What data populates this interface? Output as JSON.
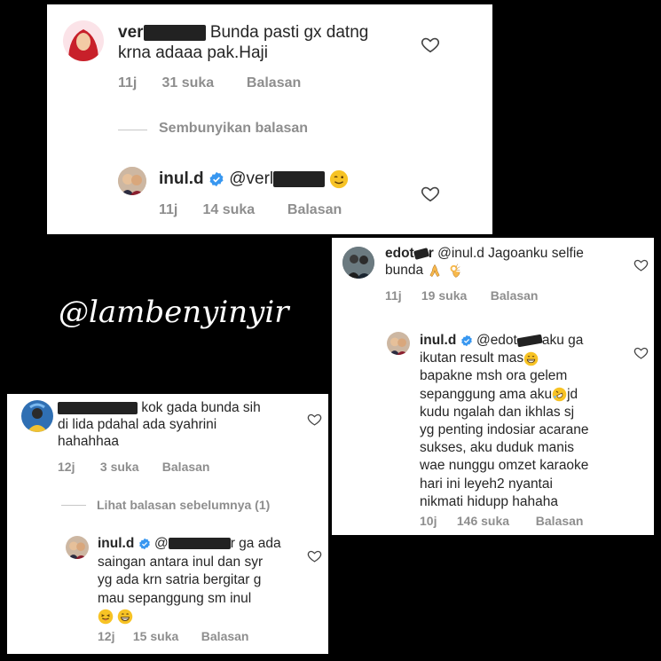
{
  "watermark": "@lambenyinyir",
  "card1": {
    "comment": {
      "username": "ver",
      "text_line1": "Bunda pasti gx datng",
      "text_line2": "krna adaaa pak.Haji",
      "time": "11j",
      "likes": "31 suka",
      "reply_label": "Balasan"
    },
    "hide_replies": "Sembunyikan balasan",
    "reply": {
      "username": "inul.d",
      "mention": "@verl",
      "time": "11j",
      "likes": "14 suka",
      "reply_label": "Balasan"
    }
  },
  "card2": {
    "comment": {
      "username": "edot",
      "username_tail": "r",
      "text_line1": "@inul.d Jagoanku selfie",
      "text_line2": "bunda",
      "time": "11j",
      "likes": "19 suka",
      "reply_label": "Balasan"
    },
    "reply": {
      "username": "inul.d",
      "mention": "@edot",
      "line1_tail": "aku ga",
      "line2": "ikutan result mas",
      "line3": "bapakne msh ora gelem",
      "line4a": "sepanggung ama aku",
      "line4b": "jd",
      "line5": "kudu ngalah dan ikhlas sj",
      "line6": "yg penting indosiar acarane",
      "line7": "sukses, aku duduk manis",
      "line8": "wae nunggu omzet karaoke",
      "line9": "hari ini leyeh2 nyantai",
      "line10": "nikmati hidupp hahaha",
      "time": "10j",
      "likes": "146 suka",
      "reply_label": "Balasan"
    }
  },
  "card3": {
    "comment": {
      "text_line1": "kok gada bunda sih",
      "text_line2": "di lida pdahal ada syahrini",
      "text_line3": "hahahhaa",
      "time": "12j",
      "likes": "3 suka",
      "reply_label": "Balasan"
    },
    "view_prev": "Lihat balasan sebelumnya (1)",
    "reply": {
      "username": "inul.d",
      "mention": "@",
      "line1_tail": "r ga ada",
      "line2": "saingan antara inul dan syr",
      "line3": "yg ada krn satria bergitar g",
      "line4": "mau sepanggung sm inul",
      "time": "12j",
      "likes": "15 suka",
      "reply_label": "Balasan"
    }
  },
  "colors": {
    "muted": "#8e8e8e",
    "verified": "#3897f0",
    "text": "#262626"
  }
}
